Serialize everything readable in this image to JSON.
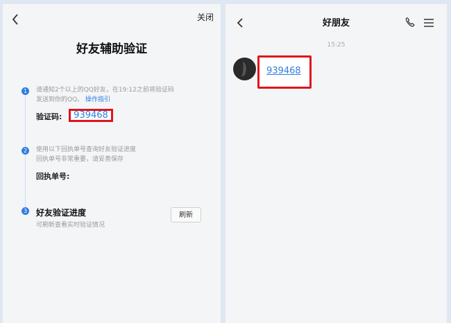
{
  "left": {
    "close_label": "关闭",
    "title": "好友辅助验证",
    "step1": {
      "num": "1",
      "desc_line1": "请通知2个以上的QQ好友，在19:12之前将验证码",
      "desc_line2": "发送到你的QQ。",
      "link": "操作指引",
      "code_label": "验证码:",
      "code": "939468"
    },
    "step2": {
      "num": "2",
      "desc_line1": "使用以下回执单号查询好友验证进度",
      "desc_line2": "回执单号非常重要，请妥善保存",
      "receipt_label": "回执单号:"
    },
    "step3": {
      "num": "3",
      "title": "好友验证进度",
      "desc": "可刷新查看实时验证情况",
      "refresh_label": "刷新"
    }
  },
  "right": {
    "title": "好朋友",
    "time": "15:25",
    "message": "939468"
  },
  "colors": {
    "accent": "#2f7de1",
    "highlight": "#e0141a"
  }
}
